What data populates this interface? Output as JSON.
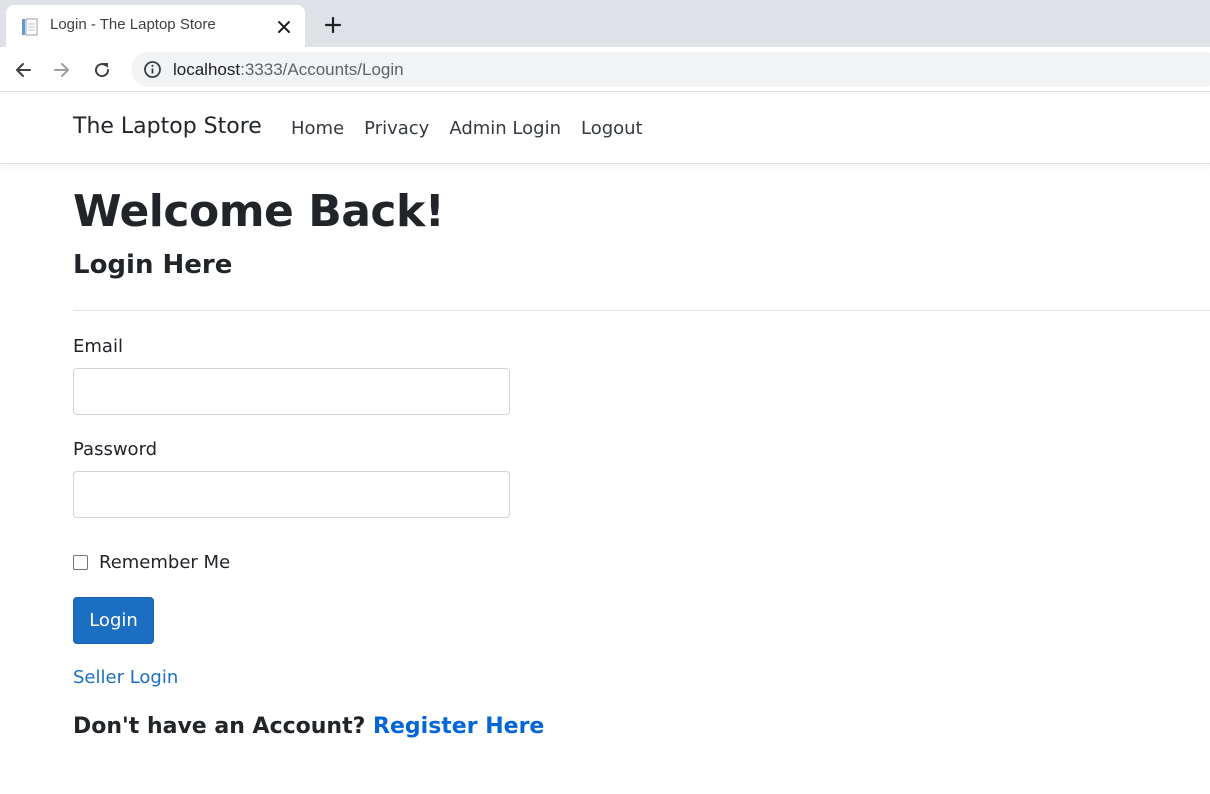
{
  "browser": {
    "tab_title": "Login - The Laptop Store",
    "url_host": "localhost",
    "url_rest": ":3333/Accounts/Login"
  },
  "navbar": {
    "brand": "The Laptop Store",
    "links": [
      "Home",
      "Privacy",
      "Admin Login",
      "Logout"
    ]
  },
  "page": {
    "heading": "Welcome Back!",
    "subheading": "Login Here"
  },
  "form": {
    "email_label": "Email",
    "email_value": "",
    "password_label": "Password",
    "password_value": "",
    "remember_label": "Remember Me",
    "remember_checked": false,
    "login_button": "Login"
  },
  "links": {
    "seller_login": "Seller Login",
    "register_prompt": "Don't have an Account?",
    "register_link": "Register Here"
  },
  "colors": {
    "primary": "#1b6ec2",
    "link": "#0366d6",
    "text": "#212529"
  }
}
